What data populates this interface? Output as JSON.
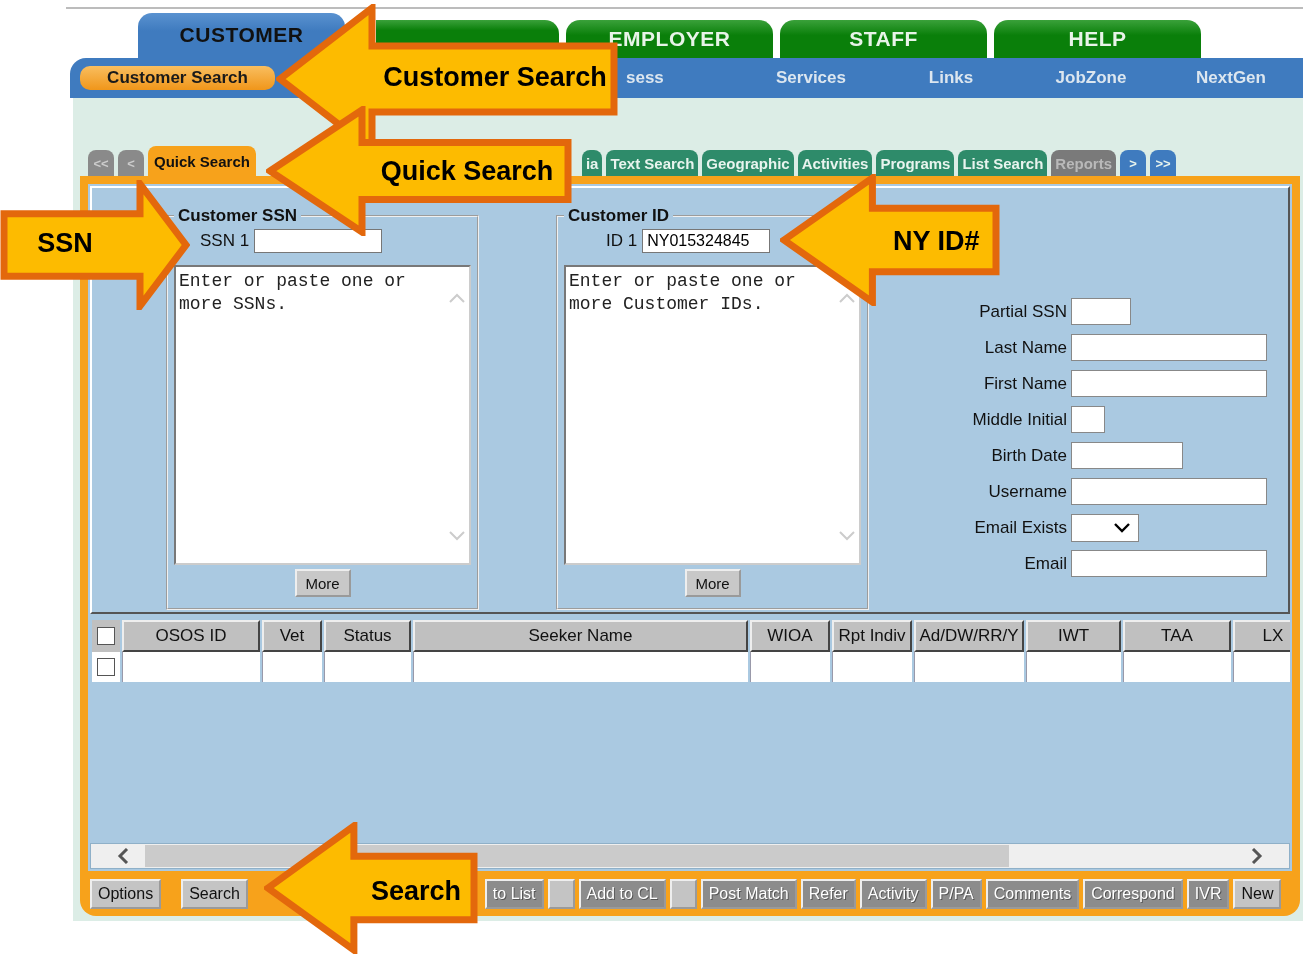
{
  "top_tabs": [
    {
      "label": "CUSTOMER",
      "selected": true
    },
    {
      "selected": false
    },
    {
      "label": "EMPLOYER",
      "selected": false
    },
    {
      "label": "STAFF",
      "selected": false
    },
    {
      "label": "HELP",
      "selected": false
    }
  ],
  "nav_items": [
    {
      "label": "Customer Search",
      "selected": true
    },
    {
      "label": "sess",
      "selected": false
    },
    {
      "label": "Services",
      "selected": false
    },
    {
      "label": "Links",
      "selected": false
    },
    {
      "label": "JobZone",
      "selected": false
    },
    {
      "label": "NextGen",
      "selected": false
    }
  ],
  "sub_tabs": [
    {
      "label": "<<",
      "kind": "arrow",
      "selected": false,
      "disabled": true
    },
    {
      "label": "<",
      "kind": "arrow",
      "selected": false,
      "disabled": true
    },
    {
      "label": "Quick Search",
      "kind": "tab",
      "selected": true,
      "disabled": false
    },
    {
      "label": "ia",
      "kind": "tab",
      "selected": false,
      "disabled": false
    },
    {
      "label": "Text Search",
      "kind": "tab",
      "selected": false,
      "disabled": false
    },
    {
      "label": "Geographic",
      "kind": "tab",
      "selected": false,
      "disabled": false
    },
    {
      "label": "Activities",
      "kind": "tab",
      "selected": false,
      "disabled": false
    },
    {
      "label": "Programs",
      "kind": "tab",
      "selected": false,
      "disabled": false
    },
    {
      "label": "List Search",
      "kind": "tab",
      "selected": false,
      "disabled": false
    },
    {
      "label": "Reports",
      "kind": "tab",
      "selected": false,
      "disabled": true
    },
    {
      "label": ">",
      "kind": "arrow",
      "selected": false,
      "disabled": false
    },
    {
      "label": ">>",
      "kind": "arrow",
      "selected": false,
      "disabled": false
    }
  ],
  "id_panels": [
    {
      "legend": "Customer SSN",
      "field_label": "SSN 1",
      "text": "Enter or paste one or more SSNs.",
      "button": "More"
    },
    {
      "legend": "Customer ID",
      "field_label": "ID 1",
      "value": "NY015324845",
      "text": "Enter or paste one or more Customer IDs.",
      "button": "More"
    }
  ],
  "form_fields": [
    {
      "label": "Partial SSN",
      "kind": "short"
    },
    {
      "label": "Last Name",
      "kind": "long"
    },
    {
      "label": "First Name",
      "kind": "long"
    },
    {
      "label": "Middle Initial",
      "kind": "tiny"
    },
    {
      "label": "Birth Date",
      "kind": "medium"
    },
    {
      "label": "Username",
      "kind": "long"
    },
    {
      "label": "Email Exists",
      "kind": "select"
    },
    {
      "label": "Email",
      "kind": "long"
    }
  ],
  "table": {
    "header_checked": false,
    "columns": [
      "OSOS ID",
      "Vet",
      "Status",
      "Seeker Name",
      "WIOA",
      "Rpt Indiv",
      "Ad/DW/RR/Y",
      "IWT",
      "TAA",
      "LX"
    ],
    "rows": [
      {
        "checked": false
      }
    ]
  },
  "buttons": [
    {
      "label": "Options",
      "kind": "button",
      "disabled": false
    },
    {
      "label": "Search",
      "kind": "button",
      "disabled": false
    },
    {
      "label": "to List",
      "kind": "button",
      "disabled": true
    },
    {
      "kind": "blank"
    },
    {
      "label": "Add to CL",
      "kind": "button",
      "disabled": true
    },
    {
      "kind": "blank"
    },
    {
      "label": "Post Match",
      "kind": "button",
      "disabled": true
    },
    {
      "label": "Refer",
      "kind": "button",
      "disabled": true
    },
    {
      "label": "Activity",
      "kind": "button",
      "disabled": true
    },
    {
      "label": "P/PA",
      "kind": "button",
      "disabled": true
    },
    {
      "label": "Comments",
      "kind": "button",
      "disabled": true
    },
    {
      "label": "Correspond",
      "kind": "button",
      "disabled": true
    },
    {
      "label": "IVR",
      "kind": "button",
      "disabled": true
    },
    {
      "label": "New",
      "kind": "button",
      "disabled": false
    }
  ],
  "callouts": [
    {
      "label": "Customer Search",
      "kind": "left_arrow"
    },
    {
      "label": "Quick Search",
      "kind": "left_arrow"
    },
    {
      "label": "SSN",
      "kind": "right_arrow"
    },
    {
      "label": "NY ID#",
      "kind": "left_arrow"
    },
    {
      "label": "Search",
      "kind": "left_arrow"
    }
  ]
}
